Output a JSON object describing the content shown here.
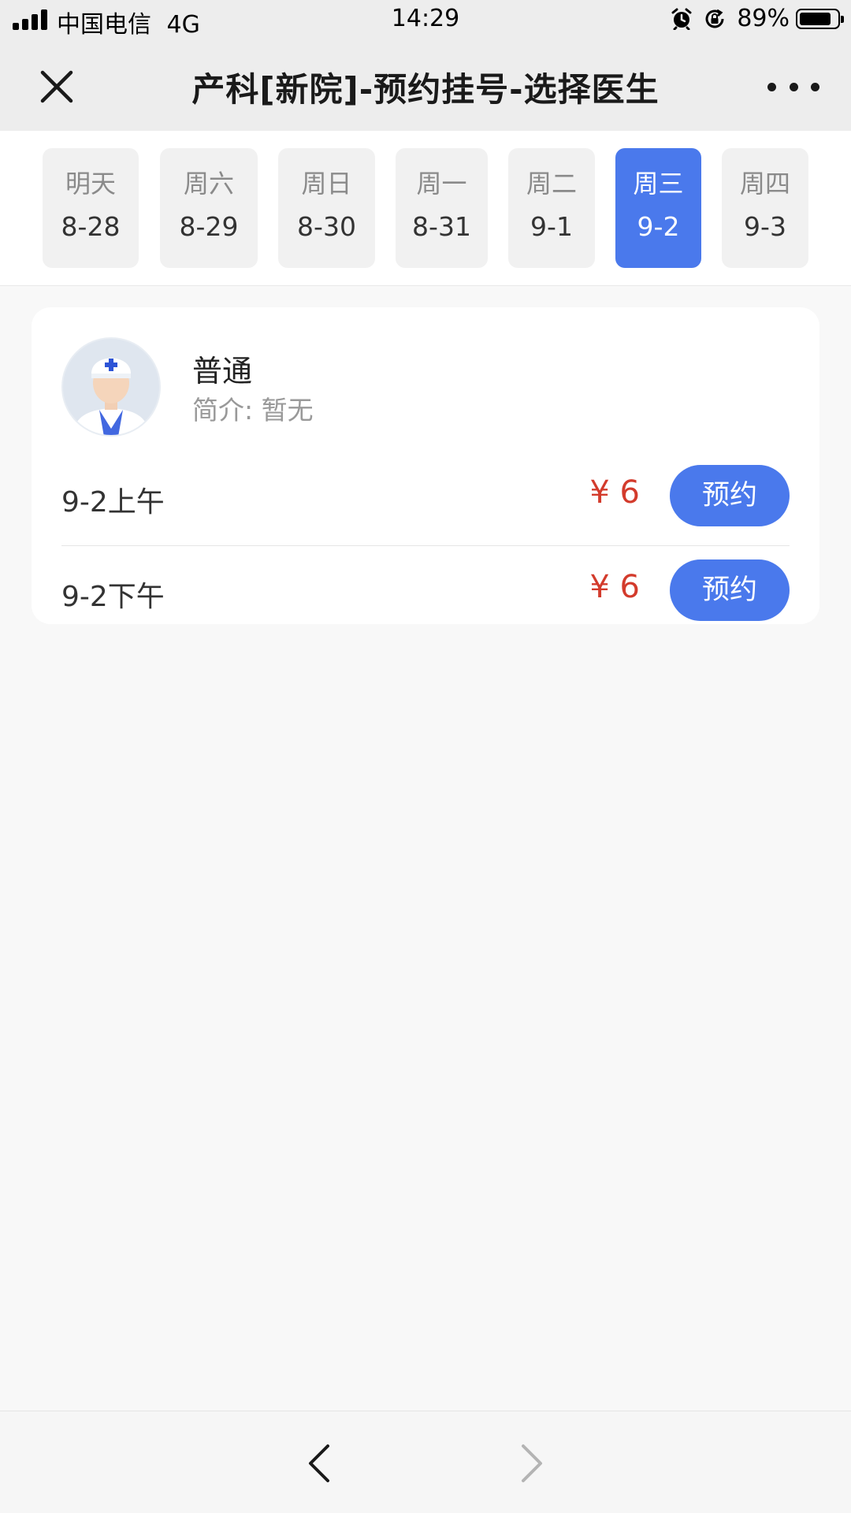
{
  "status_bar": {
    "carrier": "中国电信",
    "network": "4G",
    "time": "14:29",
    "battery_percent": "89%",
    "battery_level": 0.89,
    "icons": [
      "signal-icon",
      "alarm-icon",
      "rotation-lock-icon",
      "battery-icon"
    ]
  },
  "nav": {
    "title": "产科[新院]-预约挂号-选择医生",
    "icons": [
      "close-icon",
      "more-icon"
    ]
  },
  "dates": [
    {
      "day": "明天",
      "date": "8-28"
    },
    {
      "day": "周六",
      "date": "8-29"
    },
    {
      "day": "周日",
      "date": "8-30"
    },
    {
      "day": "周一",
      "date": "8-31"
    },
    {
      "day": "周二",
      "date": "9-1"
    },
    {
      "day": "周三",
      "date": "9-2"
    },
    {
      "day": "周四",
      "date": "9-3"
    }
  ],
  "selected_date": "9-2",
  "doctor": {
    "name": "普通",
    "intro": "简介: 暂无",
    "avatar_icon": "doctor-avatar-icon"
  },
  "slots": [
    {
      "label": "9-2上午",
      "price": "¥ 6",
      "button": "预约"
    },
    {
      "label": "9-2下午",
      "price": "¥ 6",
      "button": "预约"
    }
  ],
  "bottom": {
    "icons": [
      "back-arrow-icon",
      "forward-arrow-icon"
    ]
  },
  "colors": {
    "accent": "#4a79ec",
    "price": "#d33b2c",
    "background": "#f8f8f8",
    "nav_background": "#ededed"
  }
}
